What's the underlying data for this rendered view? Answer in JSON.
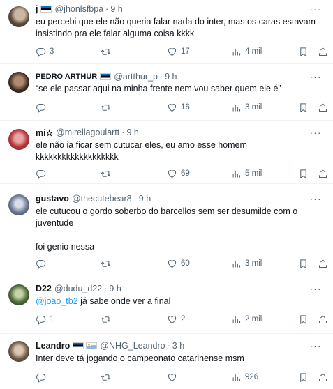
{
  "tweets": [
    {
      "name": "j",
      "flags": [
        "estonia"
      ],
      "handle": "@jhonlsfbpa",
      "time": "9 h",
      "text": "eu percebi que ele não queria falar nada do inter, mas os caras estavam insistindo pra ele falar alguma coisa kkkk",
      "replies": "3",
      "retweets": "",
      "likes": "17",
      "views": "4 mil"
    },
    {
      "name": "PEDRO ARTHUR",
      "flags": [
        "estonia"
      ],
      "handle": "@artthur_p",
      "time": "9 h",
      "text": "“se ele passar aqui na minha frente nem vou saber quem ele é”",
      "replies": "",
      "retweets": "",
      "likes": "16",
      "views": "3 mil"
    },
    {
      "name": "mi✫",
      "flags": [],
      "handle": "@mirellagoulartt",
      "time": "9 h",
      "text": "ele não ia ficar sem cutucar eles, eu amo esse homem kkkkkkkkkkkkkkkkkkk",
      "replies": "",
      "retweets": "",
      "likes": "69",
      "views": "5 mil"
    },
    {
      "name": "gustavo",
      "flags": [],
      "handle": "@thecutebear8",
      "time": "9 h",
      "text": "ele cutucou o gordo soberbo do barcellos sem ser desumilde com o juventude\n\nfoi genio nessa",
      "replies": "",
      "retweets": "",
      "likes": "60",
      "views": "3 mil"
    },
    {
      "name": "D22",
      "flags": [],
      "handle": "@dudu_d22",
      "time": "9 h",
      "mention": "@joao_tb2",
      "text": " já sabe onde ver a final",
      "replies": "1",
      "retweets": "",
      "likes": "2",
      "views": "2 mil"
    },
    {
      "name": "Leandro",
      "flags": [
        "estonia",
        "uruguay"
      ],
      "handle": "@NHG_Leandro",
      "time": "3 h",
      "text": "Inter deve tá jogando o campeonato catarinense msm",
      "replies": "",
      "retweets": "",
      "likes": "",
      "views": "926"
    }
  ],
  "separator": "·",
  "more_glyph": "···",
  "icons": {
    "reply": "reply-icon",
    "retweet": "retweet-icon",
    "like": "heart-icon",
    "views": "views-chart-icon",
    "bookmark": "bookmark-icon",
    "share": "share-icon"
  },
  "colors": {
    "text": "#0f1419",
    "secondary": "#536471",
    "link": "#1d9bf0",
    "divider": "#eff3f4"
  }
}
